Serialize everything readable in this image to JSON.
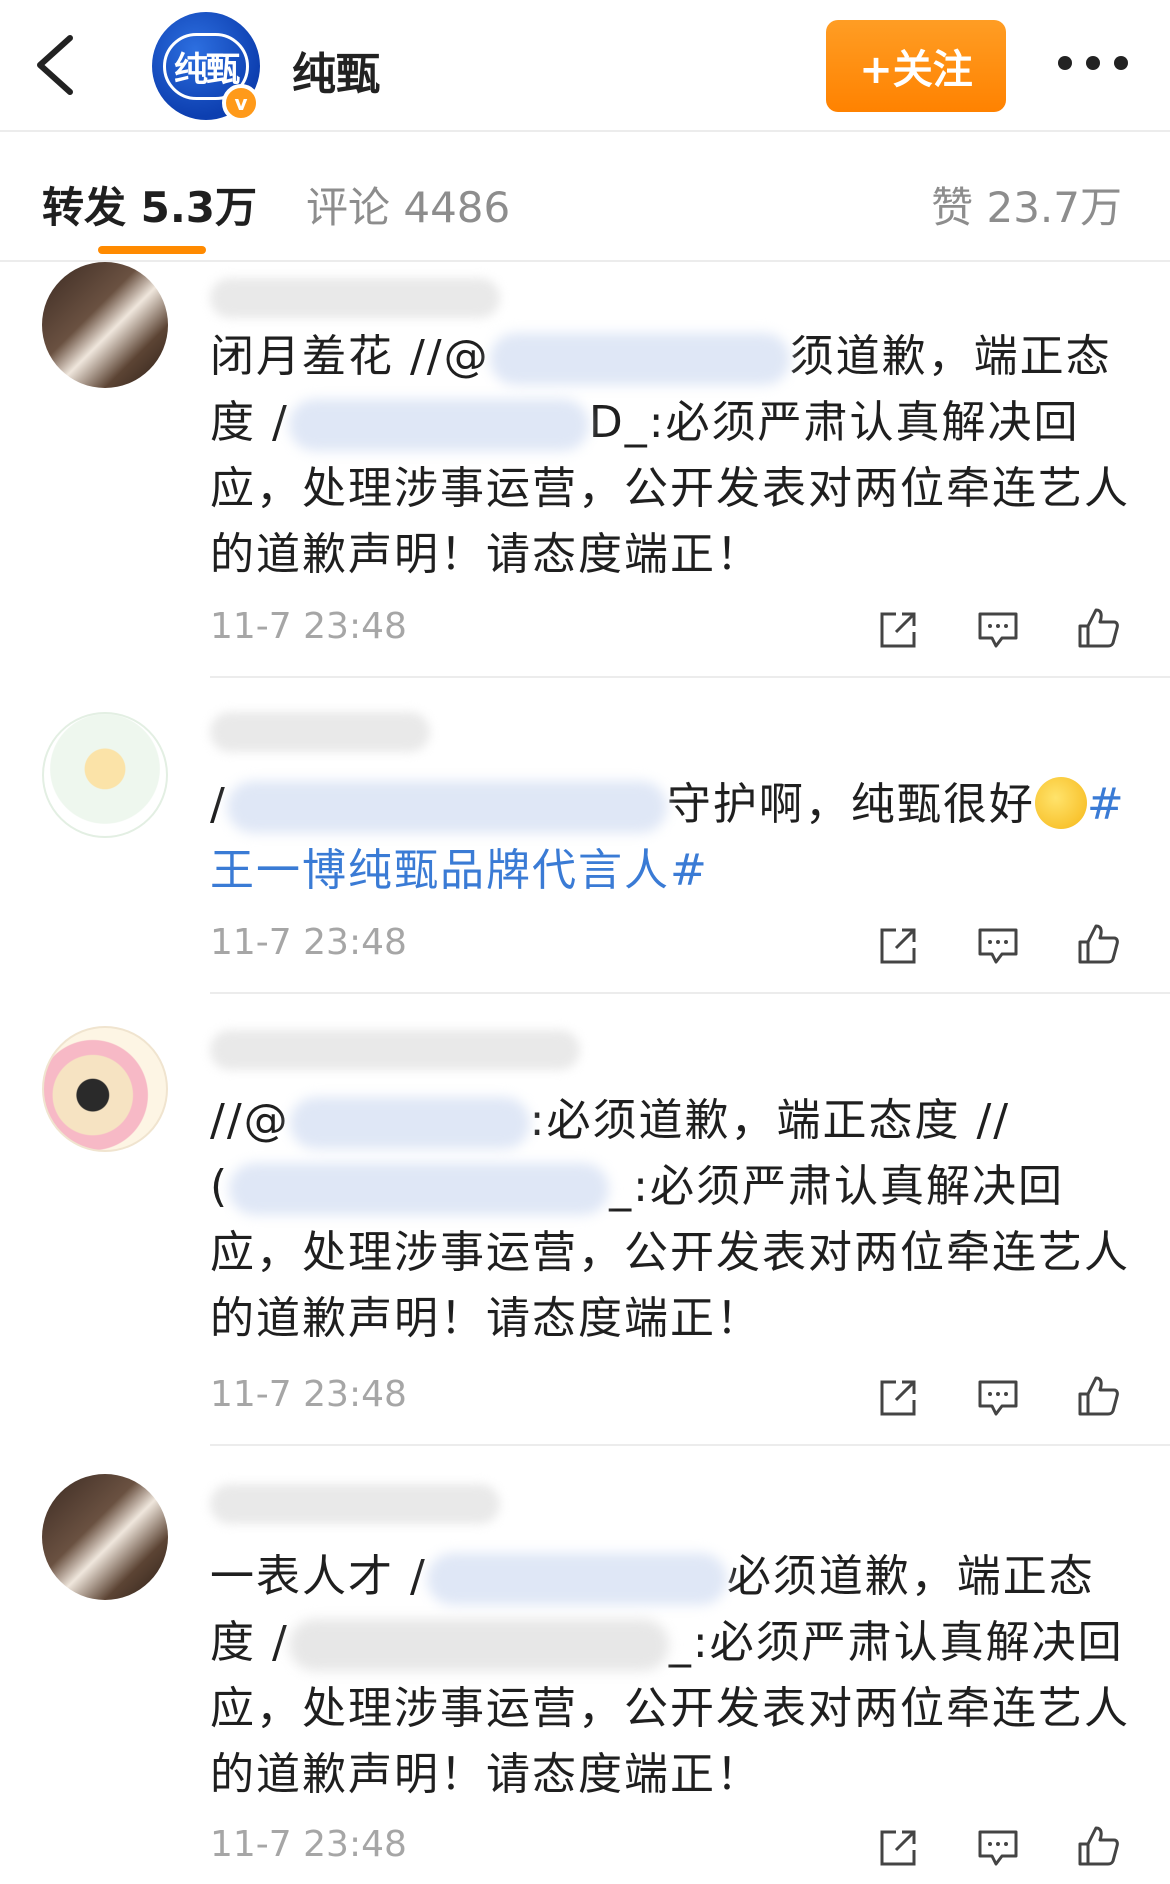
{
  "header": {
    "account_name": "纯甄",
    "logo_text": "纯甄",
    "verified_mark": "v",
    "follow_label": "+关注",
    "icons": {
      "back": "chevron-left-icon",
      "more": "ellipsis-icon"
    }
  },
  "tabs": {
    "repost": "转发 5.3万",
    "comment": "评论 4486",
    "like": "赞 23.7万",
    "active": "repost",
    "accent_color": "#ff8a00"
  },
  "comments": [
    {
      "avatar": "photo-avatar",
      "line1_pre": "闭月羞花 //@",
      "line1_post": "须道歉，端正态",
      "line2_pre": "度 /",
      "line2_post": "D_:必须严肃认真解决回",
      "line3": "应，处理涉事运营，公开发表对两位牵连艺人",
      "line4": "的道歉声明！请态度端正！",
      "time": "11-7 23:48"
    },
    {
      "avatar": "cartoon-avatar",
      "line1_pre": "/",
      "line1_post": "守护啊，纯甄很好",
      "hashtag_start": "#",
      "hashtag_rest": "王一博纯甄品牌代言人#",
      "time": "11-7 23:48"
    },
    {
      "avatar": "illustration-avatar",
      "line1_pre": "//@",
      "line1_post": ":必须道歉，端正态度 //",
      "line2_pre": "(",
      "line2_post": "_:必须严肃认真解决回",
      "line3": "应，处理涉事运营，公开发表对两位牵连艺人",
      "line4": "的道歉声明！请态度端正！",
      "time": "11-7 23:48"
    },
    {
      "avatar": "photo-avatar",
      "line1_pre": "一表人才 /",
      "line1_post": "必须道歉，端正态",
      "line2_pre": "度 /",
      "line2_post": "_:必须严肃认真解决回",
      "line3": "应，处理涉事运营，公开发表对两位牵连艺人",
      "line4": "的道歉声明！请态度端正！",
      "time": "11-7 23:48"
    }
  ],
  "action_icons": [
    "share-icon",
    "comment-icon",
    "like-icon"
  ]
}
